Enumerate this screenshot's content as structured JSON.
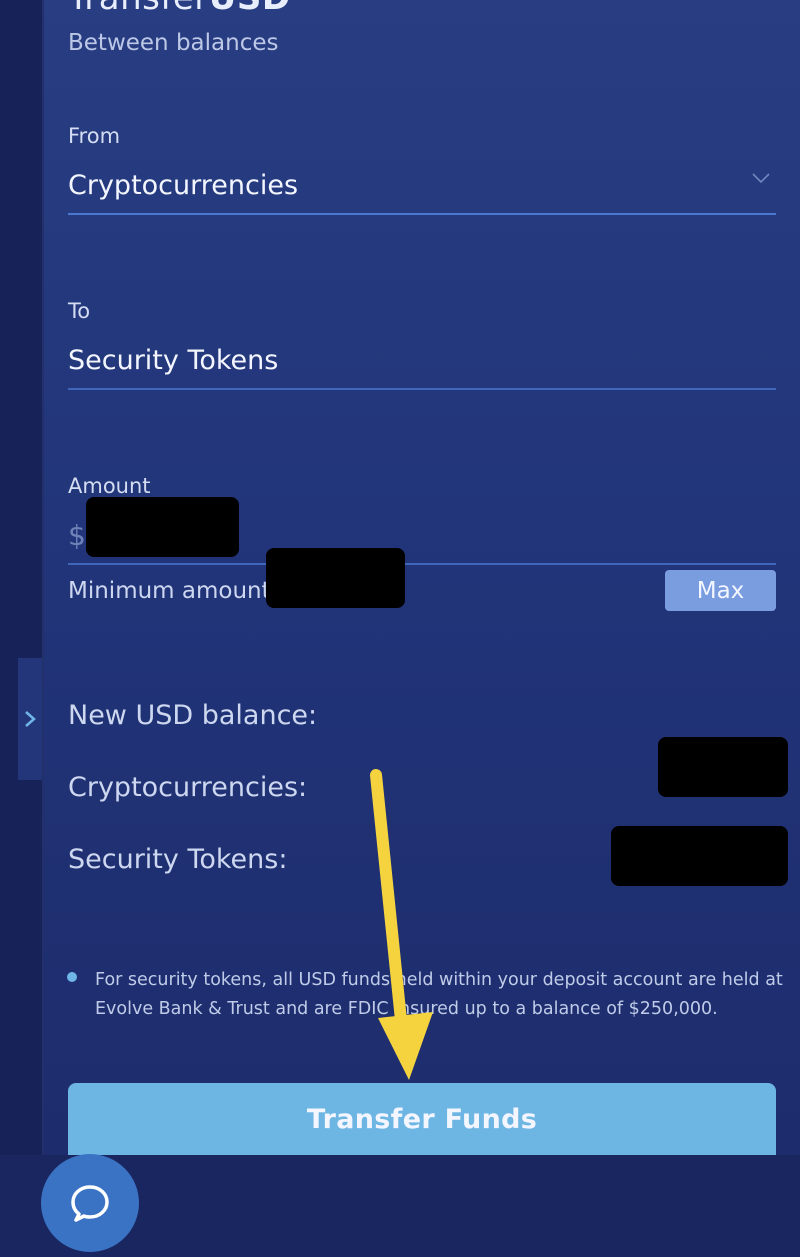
{
  "header": {
    "title_part1": "Transfer",
    "title_part2": "USD",
    "subtitle": "Between balances"
  },
  "form": {
    "from_label": "From",
    "from_value": "Cryptocurrencies",
    "to_label": "To",
    "to_value": "Security Tokens",
    "amount_label": "Amount",
    "currency_symbol": "$",
    "minimum_label": "Minimum amount",
    "max_button": "Max"
  },
  "balances": {
    "heading": "New USD balance:",
    "crypto_label": "Cryptocurrencies:",
    "security_label": "Security Tokens:"
  },
  "note": {
    "text": "For security tokens, all USD funds held within your deposit account are held at Evolve Bank & Trust and are FDIC insured up to a balance of $250,000."
  },
  "actions": {
    "transfer_button": "Transfer Funds"
  },
  "icons": {
    "dropdown": "chevron-down-icon",
    "sidebar_toggle": "chevron-right-icon",
    "chat": "chat-bubble-icon",
    "annotation": "arrow-annotation-icon"
  },
  "colors": {
    "accent": "#6db5e3",
    "max_button": "#7a9de0",
    "annotation_arrow": "#f5d33f"
  }
}
